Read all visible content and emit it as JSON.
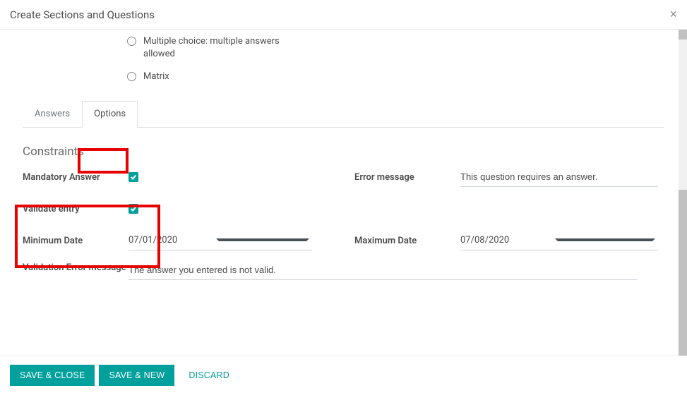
{
  "header": {
    "title": "Create Sections and Questions"
  },
  "question_types": {
    "multiple_choice_multi": "Multiple choice: multiple answers allowed",
    "matrix": "Matrix"
  },
  "tabs": {
    "answers": "Answers",
    "options": "Options"
  },
  "section": {
    "constraints": "Constraints"
  },
  "labels": {
    "mandatory_answer": "Mandatory Answer",
    "error_message": "Error message",
    "validate_entry": "Validate entry",
    "minimum_date": "Minimum Date",
    "maximum_date": "Maximum Date",
    "validation_error_message": "Validation Error message"
  },
  "values": {
    "error_message": "This question requires an answer.",
    "minimum_date": "07/01/2020",
    "maximum_date": "07/08/2020",
    "validation_error_message": "The answer you entered is not valid."
  },
  "footer": {
    "save_close": "Save & Close",
    "save_new": "Save & New",
    "discard": "Discard"
  }
}
